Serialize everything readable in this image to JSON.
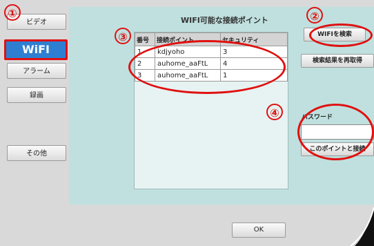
{
  "nav": {
    "video": "ビデオ",
    "wifi": "WiFI",
    "alarm": "アラーム",
    "recording": "録画",
    "other": "その他"
  },
  "main": {
    "title": "WIFI可能な接続ポイント",
    "columns": [
      "番号",
      "接続ポイント",
      "セキュリティ"
    ],
    "rows": [
      {
        "no": "1",
        "ssid": "kdjyoho",
        "security": "3"
      },
      {
        "no": "2",
        "ssid": "auhome_aaFtL",
        "security": "4"
      },
      {
        "no": "3",
        "ssid": "auhome_aaFtL",
        "security": "1"
      }
    ]
  },
  "right": {
    "search_label": "WIFIを検索",
    "rescan_label": "検索結果を再取得",
    "password_label": "パスワード",
    "password_value": "",
    "connect_label": "このポイントと接続"
  },
  "footer": {
    "ok_label": "OK"
  },
  "badges": [
    "①",
    "②",
    "③",
    "④"
  ],
  "colors": {
    "highlight": "#e01010",
    "active_nav": "#2e7fd1",
    "panel": "#bfe0de"
  }
}
